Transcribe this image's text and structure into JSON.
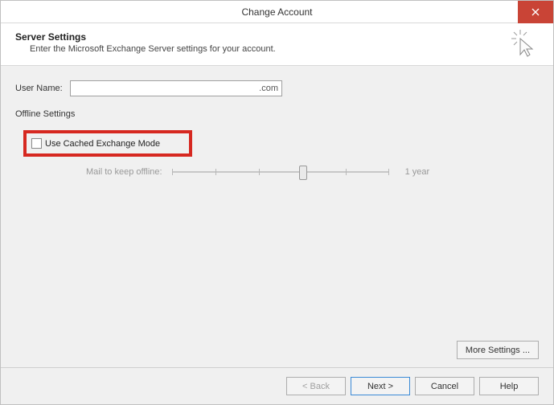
{
  "window": {
    "title": "Change Account"
  },
  "header": {
    "title": "Server Settings",
    "subtitle": "Enter the Microsoft Exchange Server settings for your account."
  },
  "form": {
    "username_label": "User Name:",
    "username_value": ".com",
    "offline_label": "Offline Settings",
    "cached_mode_label": "Use Cached Exchange Mode",
    "slider_label": "Mail to keep offline:",
    "slider_end_label": "1 year"
  },
  "buttons": {
    "more_settings": "More Settings ...",
    "back": "< Back",
    "next": "Next >",
    "cancel": "Cancel",
    "help": "Help"
  }
}
